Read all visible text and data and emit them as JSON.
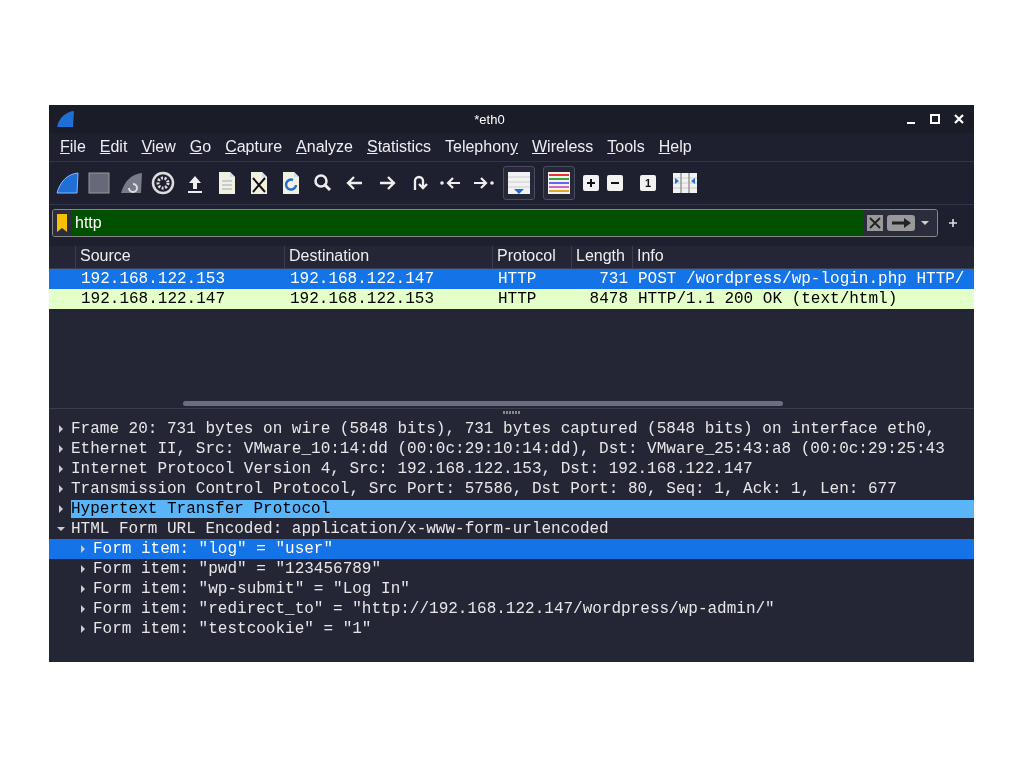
{
  "window": {
    "title": "*eth0"
  },
  "menu": [
    {
      "key": "F",
      "post": "ile"
    },
    {
      "key": "E",
      "post": "dit"
    },
    {
      "key": "V",
      "post": "iew"
    },
    {
      "key": "G",
      "post": "o"
    },
    {
      "key": "C",
      "post": "apture"
    },
    {
      "key": "A",
      "post": "nalyze"
    },
    {
      "key": "S",
      "post": "tatistics"
    },
    {
      "pre": "Telephon",
      "key": "y"
    },
    {
      "key": "W",
      "post": "ireless"
    },
    {
      "key": "T",
      "post": "ools"
    },
    {
      "key": "H",
      "post": "elp"
    }
  ],
  "toolbar": {
    "auto_scroll_on": true,
    "colorize_on": true,
    "normal_size_label": "1"
  },
  "filter": {
    "value": "http",
    "valid": true
  },
  "packet_list": {
    "columns": [
      "Source",
      "Destination",
      "Protocol",
      "Length",
      "Info"
    ],
    "rows": [
      {
        "cells": [
          "192.168.122.153",
          "192.168.122.147",
          "HTTP",
          "731",
          "POST /wordpress/wp-login.php HTTP/"
        ],
        "selected": true
      },
      {
        "cells": [
          "192.168.122.147",
          "192.168.122.153",
          "HTTP",
          "8478",
          "HTTP/1.1 200 OK  (text/html)"
        ],
        "selected": false,
        "color": "#e4ffc7"
      }
    ]
  },
  "details": [
    {
      "text": "Frame 20: 731 bytes on wire (5848 bits), 731 bytes captured (5848 bits) on interface eth0,",
      "expanded": false,
      "selected": false,
      "highlighted": false
    },
    {
      "text": "Ethernet II, Src: VMware_10:14:dd (00:0c:29:10:14:dd), Dst: VMware_25:43:a8 (00:0c:29:25:43",
      "expanded": false,
      "selected": false,
      "highlighted": false
    },
    {
      "text": "Internet Protocol Version 4, Src: 192.168.122.153, Dst: 192.168.122.147",
      "expanded": false,
      "selected": false,
      "highlighted": false
    },
    {
      "text": "Transmission Control Protocol, Src Port: 57586, Dst Port: 80, Seq: 1, Ack: 1, Len: 677",
      "expanded": false,
      "selected": false,
      "highlighted": false
    },
    {
      "text": "Hypertext Transfer Protocol",
      "expanded": false,
      "selected": false,
      "highlighted": true
    },
    {
      "text": "HTML Form URL Encoded: application/x-www-form-urlencoded",
      "expanded": true,
      "selected": false,
      "highlighted": false,
      "children": [
        {
          "text": "Form item: \"log\" = \"user\"",
          "expanded": false,
          "selected": true,
          "highlighted": false
        },
        {
          "text": "Form item: \"pwd\" = \"123456789\"",
          "expanded": false,
          "selected": false,
          "highlighted": false
        },
        {
          "text": "Form item: \"wp-submit\" = \"Log In\"",
          "expanded": false,
          "selected": false,
          "highlighted": false
        },
        {
          "text": "Form item: \"redirect_to\" = \"http://192.168.122.147/wordpress/wp-admin/\"",
          "expanded": false,
          "selected": false,
          "highlighted": false
        },
        {
          "text": "Form item: \"testcookie\" = \"1\"",
          "expanded": false,
          "selected": false,
          "highlighted": false
        }
      ]
    }
  ]
}
